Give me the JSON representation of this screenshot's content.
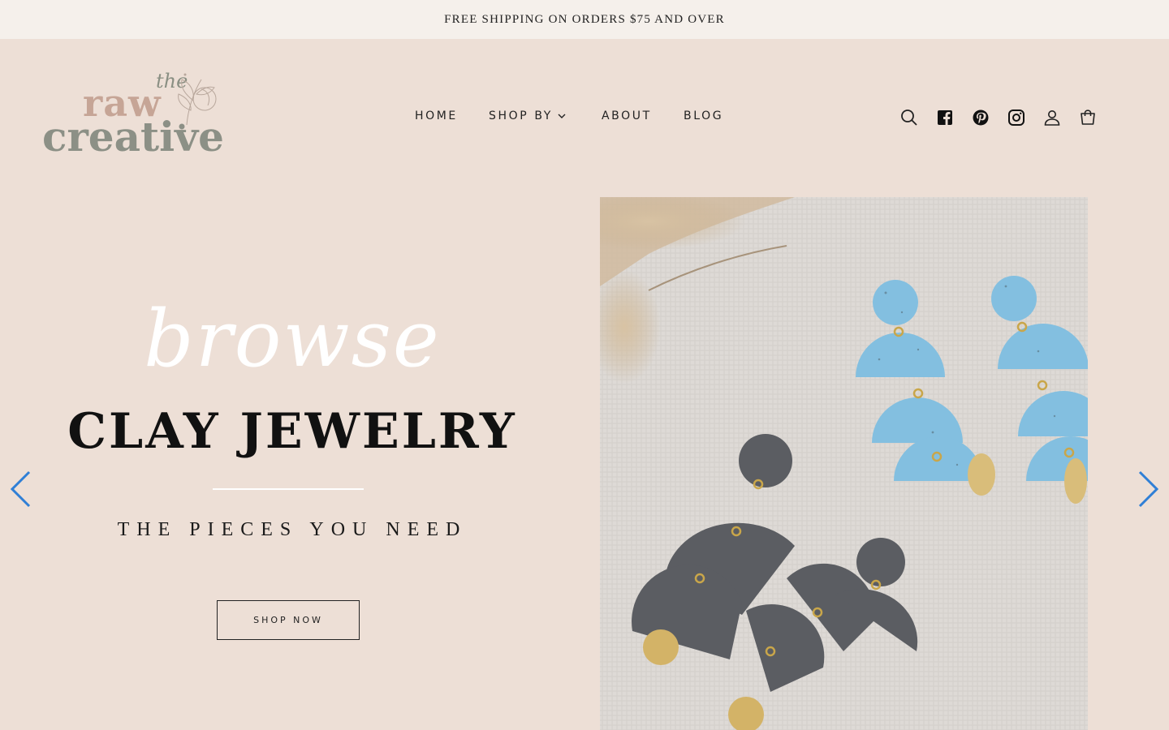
{
  "announcement": {
    "text": "FREE SHIPPING ON ORDERS $75 AND OVER"
  },
  "logo": {
    "the": "the",
    "raw": "raw",
    "creative": "creative"
  },
  "nav": {
    "items": [
      {
        "label": "HOME"
      },
      {
        "label": "SHOP BY",
        "has_dropdown": true
      },
      {
        "label": "ABOUT"
      },
      {
        "label": "BLOG"
      }
    ]
  },
  "header_icons": [
    "search-icon",
    "facebook-icon",
    "pinterest-icon",
    "instagram-icon",
    "account-icon",
    "cart-icon"
  ],
  "hero": {
    "script": "browse",
    "headline": "CLAY JEWELRY",
    "tagline": "THE PIECES YOU NEED",
    "cta": "SHOP NOW"
  },
  "slideshow": {
    "prev_icon": "chevron-left-icon",
    "next_icon": "chevron-right-icon",
    "arrow_color": "#2f7fd6"
  },
  "colors": {
    "background": "#eddfd6",
    "announcement_bg": "#f5f0eb",
    "logo_pink": "#c6a596",
    "logo_gray": "#8c9086",
    "accent_blue": "#2f7fd6"
  }
}
